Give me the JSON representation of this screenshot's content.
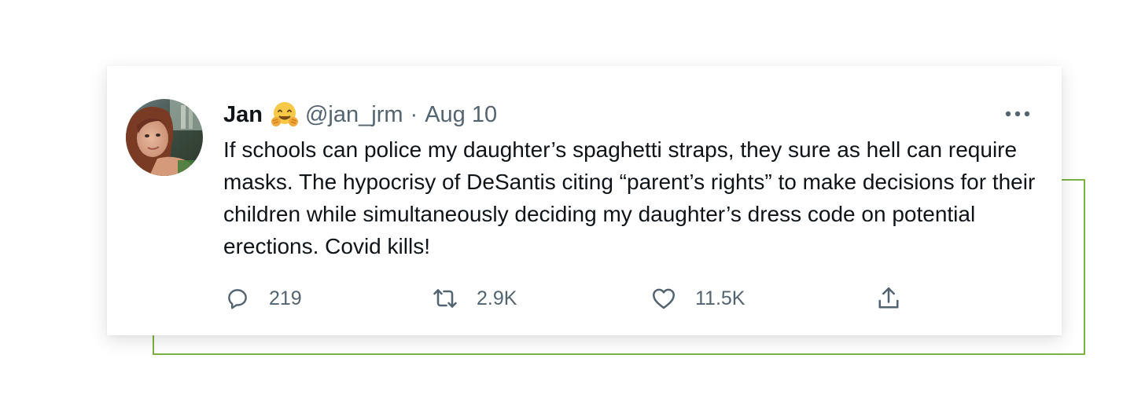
{
  "colors": {
    "accent_frame": "#7cb342",
    "text_primary": "#0f1419",
    "text_secondary": "#536471"
  },
  "tweet": {
    "author_name": "Jan",
    "author_emoji": "hugging-face-emoji",
    "handle": "@jan_jrm",
    "separator": "·",
    "date": "Aug 10",
    "text": "If schools can police my daughter’s spaghetti straps, they sure as hell can require masks. The hypocrisy of DeSantis citing “parent’s rights” to make decisions for their children while simultaneously deciding my daughter’s dress code on potential erections. Covid kills!",
    "actions": {
      "reply": {
        "icon": "reply-icon",
        "count": "219"
      },
      "retweet": {
        "icon": "retweet-icon",
        "count": "2.9K"
      },
      "like": {
        "icon": "heart-icon",
        "count": "11.5K"
      },
      "share": {
        "icon": "share-icon"
      }
    },
    "more_icon": "more-options-icon"
  }
}
